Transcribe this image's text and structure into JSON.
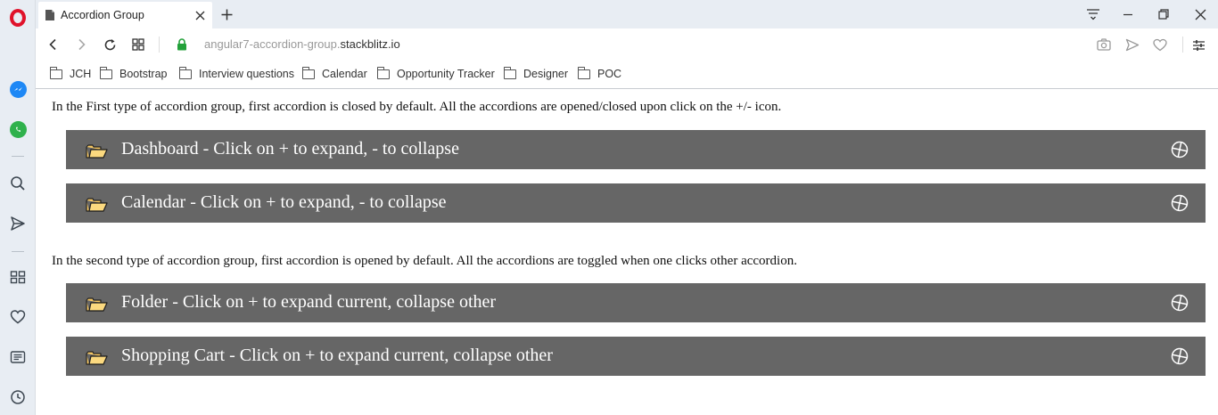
{
  "browser": {
    "tab_title": "Accordion Group",
    "url_prefix": "angular7-accordion-group.",
    "url_domain": "stackblitz.io"
  },
  "bookmarks": [
    {
      "label": "JCH"
    },
    {
      "label": "Bootstrap"
    },
    {
      "label": "Interview questions"
    },
    {
      "label": "Calendar"
    },
    {
      "label": "Opportunity Tracker"
    },
    {
      "label": "Designer"
    },
    {
      "label": "POC"
    }
  ],
  "page": {
    "group1_description": "In the First type of accordion group, first accordion is closed by default. All the accordions are opened/closed upon click on the +/- icon.",
    "group1": [
      {
        "title": "Dashboard - Click on + to expand, - to collapse"
      },
      {
        "title": "Calendar - Click on + to expand, - to collapse"
      }
    ],
    "group2_description": "In the second type of accordion group, first accordion is opened by default. All the accordions are toggled when one clicks other accordion.",
    "group2": [
      {
        "title": "Folder - Click on + to expand current, collapse other"
      },
      {
        "title": "Shopping Cart - Click on + to expand current, collapse other"
      }
    ]
  },
  "colors": {
    "accordion_header": "#666666",
    "folder_fill": "#f7c863",
    "opera_red": "#e0122a",
    "messenger_blue": "#1e88f5",
    "whatsapp_green": "#2fb14c",
    "secure_lock_green": "#23a13a"
  }
}
